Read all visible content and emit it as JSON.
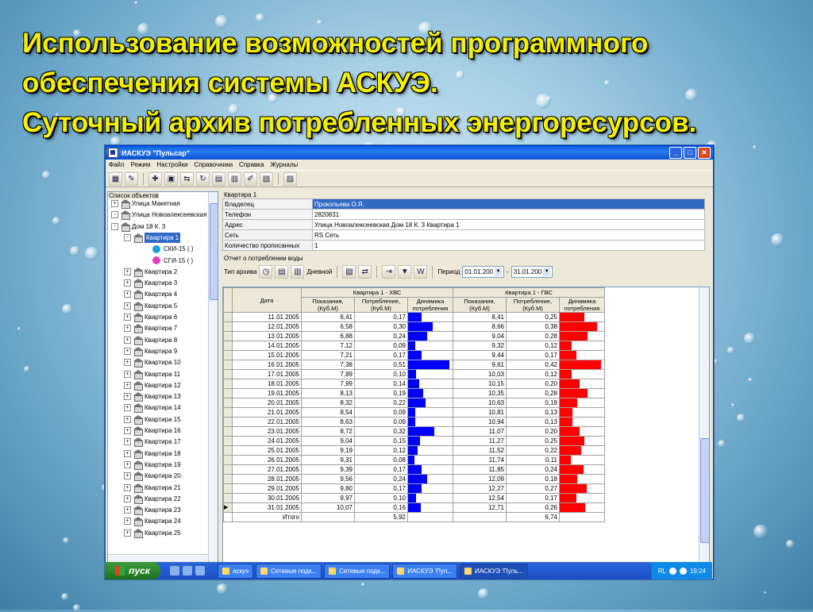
{
  "slide": {
    "title_lines": [
      "Использование возможностей программного",
      "обеспечения системы АСКУЭ.",
      "Суточный архив потребленных энергоресурсов."
    ]
  },
  "window": {
    "title": "ИАСКУЭ \"Пульсар\"",
    "menu": [
      "Файл",
      "Режим",
      "Настройки",
      "Справочники",
      "Справка",
      "Журналы"
    ]
  },
  "left_panel": {
    "caption": "Список объектов",
    "tree": [
      {
        "label": "Улица Макетная",
        "level": 0,
        "exp": "+",
        "icon": "house-icon"
      },
      {
        "label": "Улица Новоалексеевская",
        "level": 0,
        "exp": "-",
        "icon": "house-icon"
      },
      {
        "label": "Дом 18 К. 3",
        "level": 1,
        "exp": "-",
        "icon": "house-icon"
      },
      {
        "label": "Квартира 1",
        "level": 2,
        "exp": "-",
        "icon": "house-icon",
        "selected": true
      },
      {
        "label": "СКИ-15 ( )",
        "level": 3,
        "icon": "meter-icon",
        "color": "#1aa0e0"
      },
      {
        "label": "СГИ-15 ( )",
        "level": 3,
        "icon": "meter-icon",
        "color": "#e040c0"
      },
      {
        "label": "Квартира 2",
        "level": 2,
        "exp": "+",
        "icon": "house-icon"
      },
      {
        "label": "Квартира 3",
        "level": 2,
        "exp": "+",
        "icon": "house-icon"
      },
      {
        "label": "Квартира 4",
        "level": 2,
        "exp": "+",
        "icon": "house-icon"
      },
      {
        "label": "Квартира 5",
        "level": 2,
        "exp": "+",
        "icon": "house-icon"
      },
      {
        "label": "Квартира 6",
        "level": 2,
        "exp": "+",
        "icon": "house-icon"
      },
      {
        "label": "Квартира 7",
        "level": 2,
        "exp": "+",
        "icon": "house-icon"
      },
      {
        "label": "Квартира 8",
        "level": 2,
        "exp": "+",
        "icon": "house-icon"
      },
      {
        "label": "Квартира 9",
        "level": 2,
        "exp": "+",
        "icon": "house-icon"
      },
      {
        "label": "Квартира 10",
        "level": 2,
        "exp": "+",
        "icon": "house-icon"
      },
      {
        "label": "Квартира 11",
        "level": 2,
        "exp": "+",
        "icon": "house-icon"
      },
      {
        "label": "Квартира 12",
        "level": 2,
        "exp": "+",
        "icon": "house-icon"
      },
      {
        "label": "Квартира 13",
        "level": 2,
        "exp": "+",
        "icon": "house-icon"
      },
      {
        "label": "Квартира 14",
        "level": 2,
        "exp": "+",
        "icon": "house-icon"
      },
      {
        "label": "Квартира 15",
        "level": 2,
        "exp": "+",
        "icon": "house-icon"
      },
      {
        "label": "Квартира 16",
        "level": 2,
        "exp": "+",
        "icon": "house-icon"
      },
      {
        "label": "Квартира 17",
        "level": 2,
        "exp": "+",
        "icon": "house-icon"
      },
      {
        "label": "Квартира 18",
        "level": 2,
        "exp": "+",
        "icon": "house-icon"
      },
      {
        "label": "Квартира 19",
        "level": 2,
        "exp": "+",
        "icon": "house-icon"
      },
      {
        "label": "Квартира 20",
        "level": 2,
        "exp": "+",
        "icon": "house-icon"
      },
      {
        "label": "Квартира 21",
        "level": 2,
        "exp": "+",
        "icon": "house-icon"
      },
      {
        "label": "Квартира 22",
        "level": 2,
        "exp": "+",
        "icon": "house-icon"
      },
      {
        "label": "Квартира 23",
        "level": 2,
        "exp": "+",
        "icon": "house-icon"
      },
      {
        "label": "Квартира 24",
        "level": 2,
        "exp": "+",
        "icon": "house-icon"
      },
      {
        "label": "Квартира 25",
        "level": 2,
        "exp": "+",
        "icon": "house-icon"
      }
    ]
  },
  "info": {
    "caption": "Квартира 1",
    "rows": [
      {
        "key": "Владелец",
        "value": "Прокопьева О.Я.",
        "selected": true
      },
      {
        "key": "Телефон",
        "value": "2820831"
      },
      {
        "key": "Адрес",
        "value": "Улица Новоалексеевская  Дом 18 К. 3  Квартира 1"
      },
      {
        "key": "Сеть",
        "value": "RS Сеть"
      },
      {
        "key": "Количество прописанных",
        "value": "1"
      }
    ]
  },
  "report": {
    "caption": "Отчет о потреблении воды",
    "archive_type_label": "Тип архива",
    "archive_mode": "Дневной",
    "period_label": "Период",
    "date_from": "01.01.200",
    "date_to": "31.01.200",
    "date_sep": "-",
    "header_date": "Дата",
    "group_cold": "Квартира 1 - ХВС",
    "group_hot": "Квартира 1 - ГВС",
    "col_reading": "Показания, (Куб.М)",
    "col_consumption": "Потребление, (Куб.М)",
    "col_dynamics": "Динамика потребления",
    "total_label": "Итого",
    "total_cold": "5,92",
    "total_hot": "6,74",
    "bar_cold_color": "#0000ff",
    "bar_hot_color": "#ff0000",
    "rows": [
      {
        "date": "11.01.2005",
        "c_read": "6,41",
        "c_cons": "0,17",
        "h_read": "8,41",
        "h_cons": "0,25"
      },
      {
        "date": "12.01.2005",
        "c_read": "6,58",
        "c_cons": "0,30",
        "h_read": "8,66",
        "h_cons": "0,38"
      },
      {
        "date": "13.01.2005",
        "c_read": "6,88",
        "c_cons": "0,24",
        "h_read": "9,04",
        "h_cons": "0,28"
      },
      {
        "date": "14.01.2005",
        "c_read": "7,12",
        "c_cons": "0,09",
        "h_read": "9,32",
        "h_cons": "0,12"
      },
      {
        "date": "15.01.2005",
        "c_read": "7,21",
        "c_cons": "0,17",
        "h_read": "9,44",
        "h_cons": "0,17"
      },
      {
        "date": "16.01.2005",
        "c_read": "7,38",
        "c_cons": "0,51",
        "h_read": "9,61",
        "h_cons": "0,42"
      },
      {
        "date": "17.01.2005",
        "c_read": "7,89",
        "c_cons": "0,10",
        "h_read": "10,03",
        "h_cons": "0,12"
      },
      {
        "date": "18.01.2005",
        "c_read": "7,99",
        "c_cons": "0,14",
        "h_read": "10,15",
        "h_cons": "0,20"
      },
      {
        "date": "19.01.2005",
        "c_read": "8,13",
        "c_cons": "0,19",
        "h_read": "10,35",
        "h_cons": "0,28"
      },
      {
        "date": "20.01.2005",
        "c_read": "8,32",
        "c_cons": "0,22",
        "h_read": "10,63",
        "h_cons": "0,18"
      },
      {
        "date": "21.01.2005",
        "c_read": "8,54",
        "c_cons": "0,09",
        "h_read": "10,81",
        "h_cons": "0,13"
      },
      {
        "date": "22.01.2005",
        "c_read": "8,63",
        "c_cons": "0,09",
        "h_read": "10,94",
        "h_cons": "0,13"
      },
      {
        "date": "23.01.2005",
        "c_read": "8,72",
        "c_cons": "0,32",
        "h_read": "11,07",
        "h_cons": "0,20"
      },
      {
        "date": "24.01.2005",
        "c_read": "9,04",
        "c_cons": "0,15",
        "h_read": "11,27",
        "h_cons": "0,25"
      },
      {
        "date": "25.01.2005",
        "c_read": "9,19",
        "c_cons": "0,12",
        "h_read": "11,52",
        "h_cons": "0,22"
      },
      {
        "date": "26.01.2005",
        "c_read": "9,31",
        "c_cons": "0,08",
        "h_read": "11,74",
        "h_cons": "0,11"
      },
      {
        "date": "27.01.2005",
        "c_read": "9,39",
        "c_cons": "0,17",
        "h_read": "11,85",
        "h_cons": "0,24"
      },
      {
        "date": "28.01.2005",
        "c_read": "9,56",
        "c_cons": "0,24",
        "h_read": "12,09",
        "h_cons": "0,18"
      },
      {
        "date": "29.01.2005",
        "c_read": "9,80",
        "c_cons": "0,17",
        "h_read": "12,27",
        "h_cons": "0,27"
      },
      {
        "date": "30.01.2005",
        "c_read": "9,97",
        "c_cons": "0,10",
        "h_read": "12,54",
        "h_cons": "0,17"
      },
      {
        "date": "31.01.2005",
        "c_read": "10,07",
        "c_cons": "0,16",
        "h_read": "12,71",
        "h_cons": "0,26"
      }
    ]
  },
  "taskbar": {
    "start": "пуск",
    "tasks": [
      {
        "label": "аскуэ",
        "active": false
      },
      {
        "label": "Сетевые подк...",
        "active": false
      },
      {
        "label": "Сетевые подк...",
        "active": false
      },
      {
        "label": "ИАСКУЭ 'Пул...",
        "active": false
      },
      {
        "label": "ИАСКУЭ 'Пуль...",
        "active": true
      }
    ],
    "lang": "RL",
    "clock": "19:24"
  }
}
